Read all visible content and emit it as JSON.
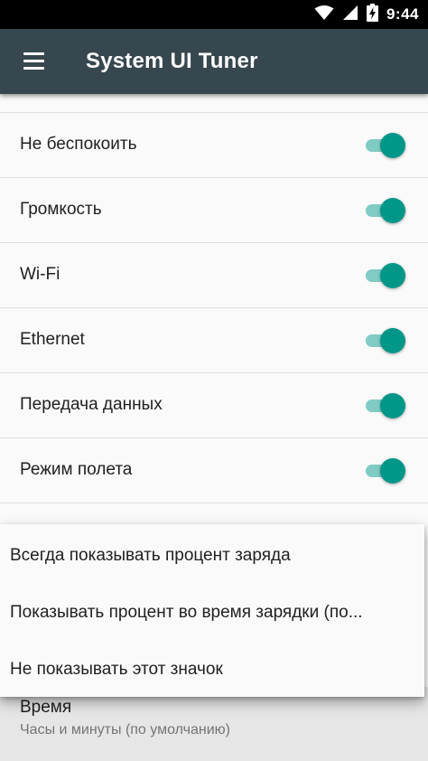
{
  "status_bar": {
    "time": "9:44",
    "icons": [
      "wifi-icon",
      "signal-icon",
      "battery-charging-icon"
    ]
  },
  "app_bar": {
    "menu_icon": "hamburger-menu-icon",
    "title": "System UI Tuner"
  },
  "toggles": [
    {
      "label": "Не беспокоить",
      "on": true
    },
    {
      "label": "Громкость",
      "on": true
    },
    {
      "label": "Wi-Fi",
      "on": true
    },
    {
      "label": "Ethernet",
      "on": true
    },
    {
      "label": "Передача данных",
      "on": true
    },
    {
      "label": "Режим полета",
      "on": true
    }
  ],
  "battery_menu": {
    "options": [
      "Всегда показывать процент заряда",
      "Показывать процент во время зарядки (по...",
      "Не показывать этот значок"
    ]
  },
  "time_setting": {
    "title": "Время",
    "summary": "Часы и минуты (по умолчанию)"
  },
  "colors": {
    "app_bar": "#37474f",
    "status_bar": "#000000",
    "toggle_thumb": "#009688",
    "toggle_track": "#80cbc4"
  }
}
